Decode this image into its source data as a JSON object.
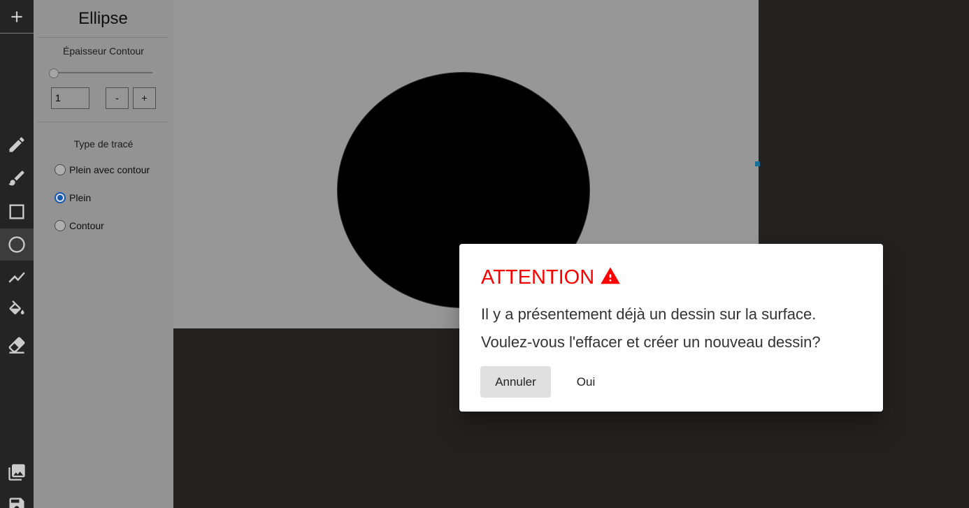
{
  "toolbar": {
    "tools": [
      "add",
      "pencil",
      "brush",
      "rectangle",
      "ellipse",
      "polyline",
      "paint-bucket",
      "eraser",
      "gallery",
      "save"
    ],
    "active_tool": "ellipse",
    "icon_color": "#e8e8e8"
  },
  "panel": {
    "title": "Ellipse",
    "stroke_width_label": "Épaisseur Contour",
    "stroke_width_value": "1",
    "minus_label": "-",
    "plus_label": "+",
    "trace_type_label": "Type de tracé",
    "options": [
      {
        "label": "Plein avec contour",
        "checked": false
      },
      {
        "label": "Plein",
        "checked": true
      },
      {
        "label": "Contour",
        "checked": false
      }
    ]
  },
  "canvas": {
    "background": "#acacac",
    "shape": "ellipse",
    "fill": "#000000"
  },
  "dialog": {
    "title": "ATTENTION",
    "title_color": "#ff0000",
    "line1": "Il y a présentement déjà un dessin sur la surface.",
    "line2": "Voulez-vous l'effacer et créer un nouveau dessin?",
    "cancel_label": "Annuler",
    "confirm_label": "Oui"
  }
}
